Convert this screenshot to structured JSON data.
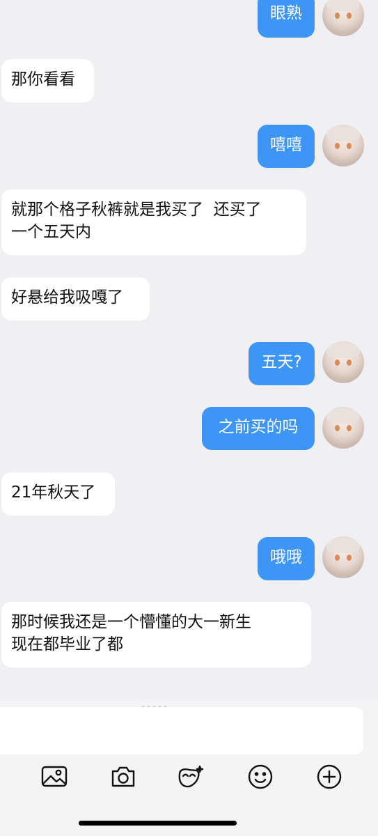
{
  "messages": [
    {
      "side": "out",
      "text": "眼熟"
    },
    {
      "side": "in",
      "text": "那你看看"
    },
    {
      "side": "out",
      "text": "嘻嘻"
    },
    {
      "side": "in",
      "text": "就那个格子秋裤就是我买了  还买了\n一个五天内"
    },
    {
      "side": "in",
      "text": "好悬给我吸嘎了"
    },
    {
      "side": "out",
      "text": "五天?"
    },
    {
      "side": "out",
      "text": "之前买的吗"
    },
    {
      "side": "in",
      "text": "21年秋天了"
    },
    {
      "side": "out",
      "text": "哦哦"
    },
    {
      "side": "in",
      "text": "那时候我还是一个懵懂的大一新生\n现在都毕业了都"
    }
  ],
  "input": {
    "value": "",
    "placeholder": ""
  },
  "toolbar": {
    "icons": [
      "image-icon",
      "camera-icon",
      "mask-sticker-icon",
      "emoji-icon",
      "plus-icon"
    ]
  },
  "colors": {
    "outgoing_bubble": "#3d95f5",
    "incoming_bubble": "#ffffff",
    "background": "#efeff4"
  }
}
